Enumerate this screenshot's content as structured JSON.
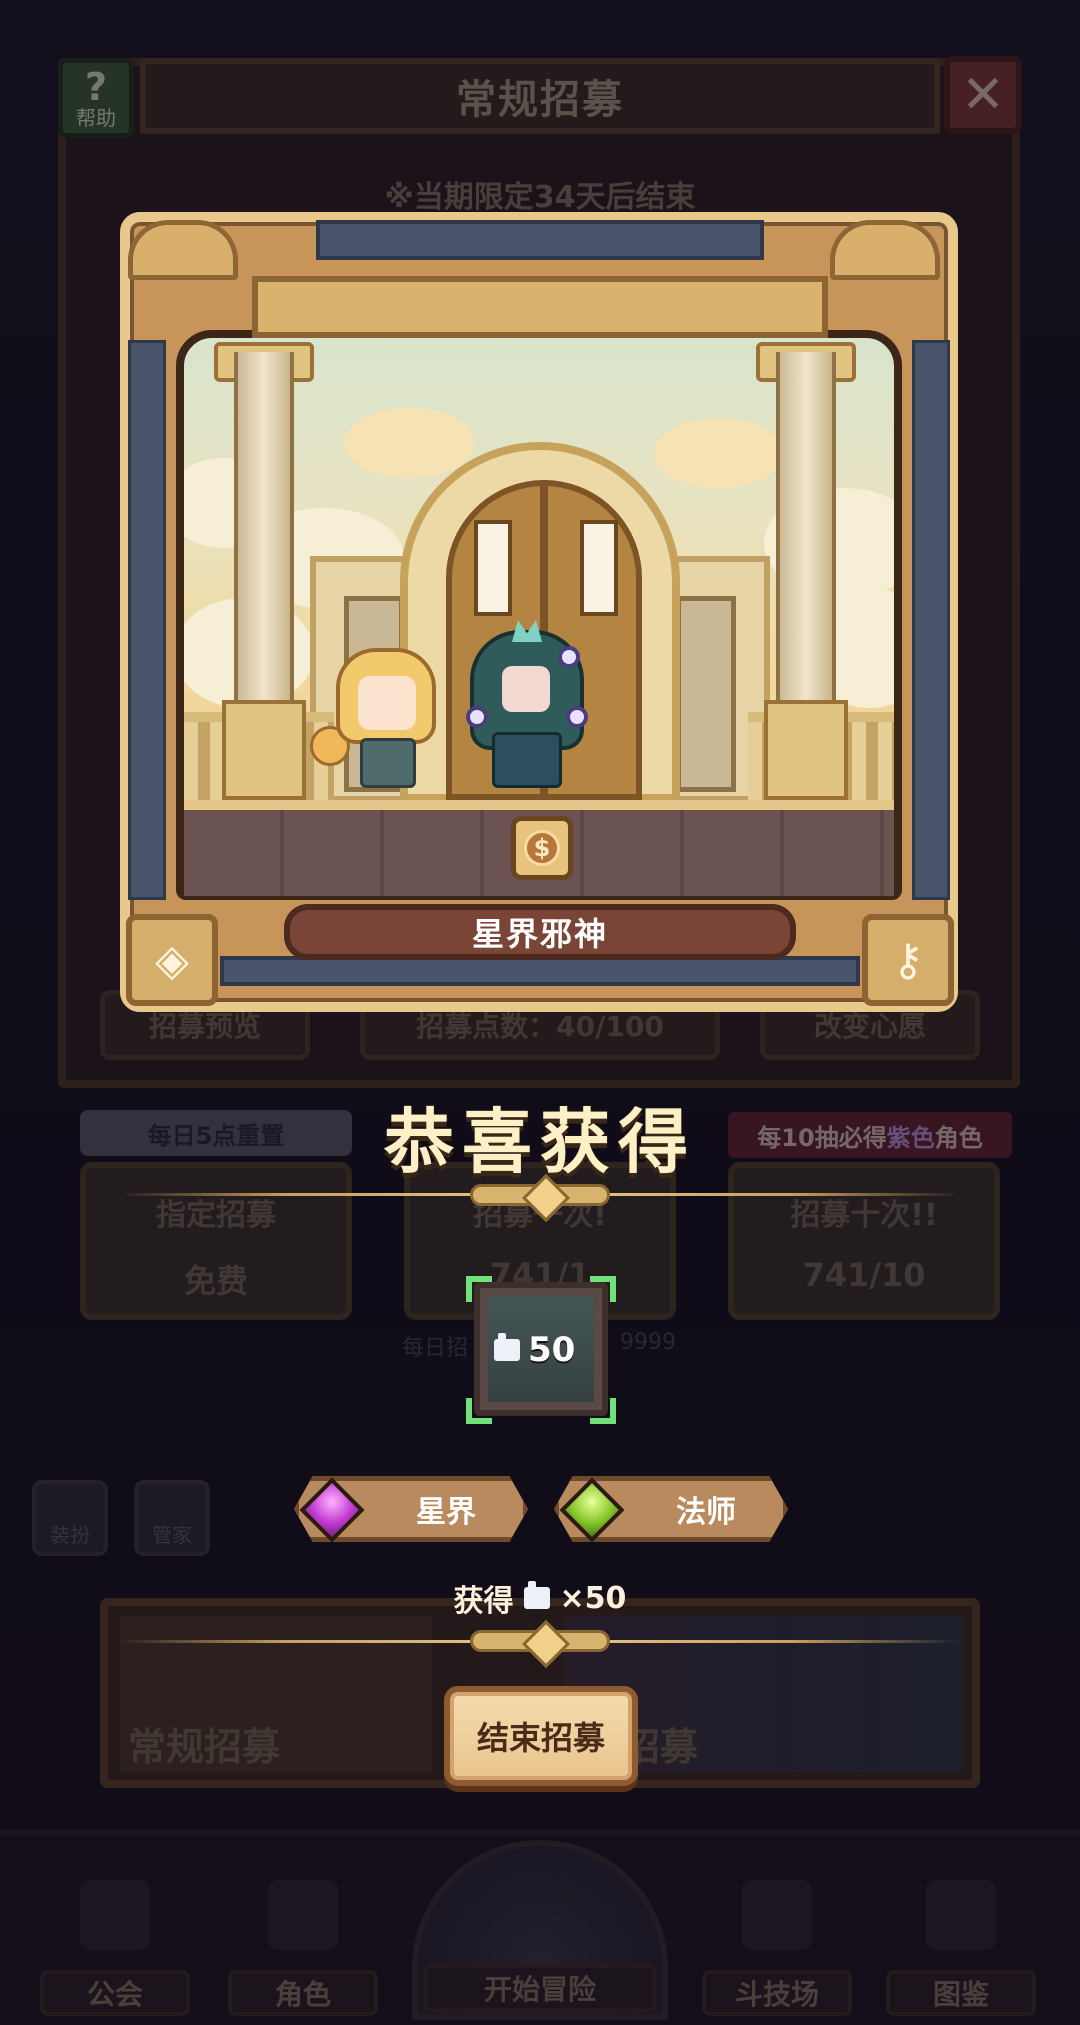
{
  "header": {
    "title": "常规招募",
    "help_label": "帮助",
    "help_glyph": "?",
    "close_glyph": "✕",
    "limit_notice": "※当期限定34天后结束"
  },
  "background": {
    "preview_label": "招募预览",
    "points_label": "招募点数：40/100",
    "wish_label": "改变心愿",
    "daily_reset_tag": "每日5点重置",
    "guarantee_tag_prefix": "每10抽必得",
    "guarantee_tag_highlight": "紫色",
    "guarantee_tag_suffix": "角色",
    "pulls": [
      {
        "title": "指定招募",
        "cost": "免费"
      },
      {
        "title": "招募一次!",
        "cost": "741/1"
      },
      {
        "title": "招募十次!!",
        "cost": "741/10"
      }
    ],
    "daily_limit_left": "每日招",
    "daily_limit_right": "9999",
    "side_buttons": [
      "装扮",
      "管家"
    ],
    "banners": [
      {
        "label": "常规招募"
      },
      {
        "label": "化招募"
      }
    ]
  },
  "reward": {
    "character_name": "星界邪神",
    "coin_glyph": "$",
    "congrats": "恭喜获得",
    "item_quantity": "50",
    "tags": [
      {
        "label": "星界",
        "gem": "purple"
      },
      {
        "label": "法师",
        "gem": "green"
      }
    ],
    "obtained_prefix": "获得",
    "obtained_suffix": "×50",
    "end_button": "结束招募"
  },
  "navbar": {
    "items": [
      "公会",
      "角色",
      "开始冒险",
      "斗技场",
      "图鉴"
    ]
  },
  "colors": {
    "gold": "#e9c98b",
    "name_plate": "#7a4536",
    "congrats_text": "#fbf0c6",
    "selected_corner": "#6fe07a"
  }
}
